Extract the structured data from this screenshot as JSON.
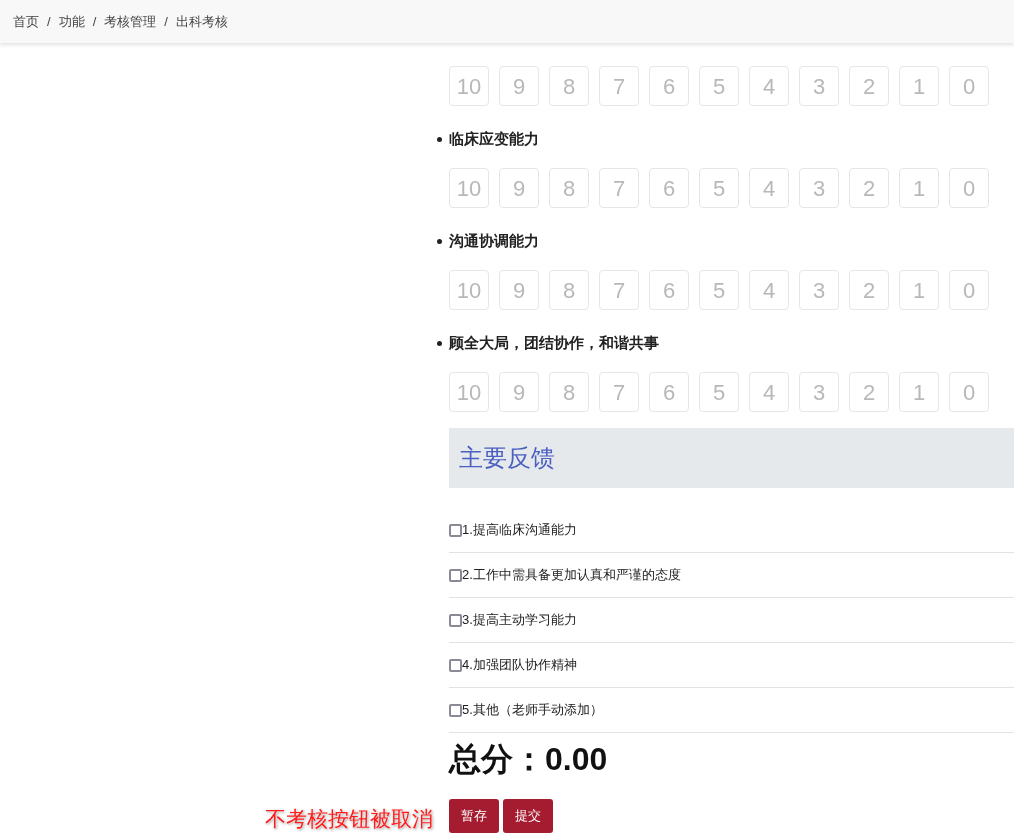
{
  "breadcrumb": [
    "首页",
    "功能",
    "考核管理",
    "出科考核"
  ],
  "breadcrumb_separator": "/",
  "first_scores": [
    "10",
    "9",
    "8",
    "7",
    "6",
    "5",
    "4",
    "3",
    "2",
    "1",
    "0"
  ],
  "criteria": [
    {
      "title": "临床应变能力",
      "scores": [
        "10",
        "9",
        "8",
        "7",
        "6",
        "5",
        "4",
        "3",
        "2",
        "1",
        "0"
      ]
    },
    {
      "title": "沟通协调能力",
      "scores": [
        "10",
        "9",
        "8",
        "7",
        "6",
        "5",
        "4",
        "3",
        "2",
        "1",
        "0"
      ]
    },
    {
      "title": "顾全大局，团结协作，和谐共事",
      "scores": [
        "10",
        "9",
        "8",
        "7",
        "6",
        "5",
        "4",
        "3",
        "2",
        "1",
        "0"
      ]
    }
  ],
  "feedback": {
    "title": "主要反馈",
    "items": [
      {
        "label": "1.提高临床沟通能力",
        "checked": false
      },
      {
        "label": "2.工作中需具备更加认真和严谨的态度",
        "checked": false
      },
      {
        "label": "3.提高主动学习能力",
        "checked": false
      },
      {
        "label": "4.加强团队协作精神",
        "checked": false
      },
      {
        "label": "5.其他（老师手动添加）",
        "checked": false
      }
    ]
  },
  "total": "总分：0.00",
  "buttons": [
    "暂存",
    "提交"
  ],
  "annotation": "不考核按钮被取消"
}
